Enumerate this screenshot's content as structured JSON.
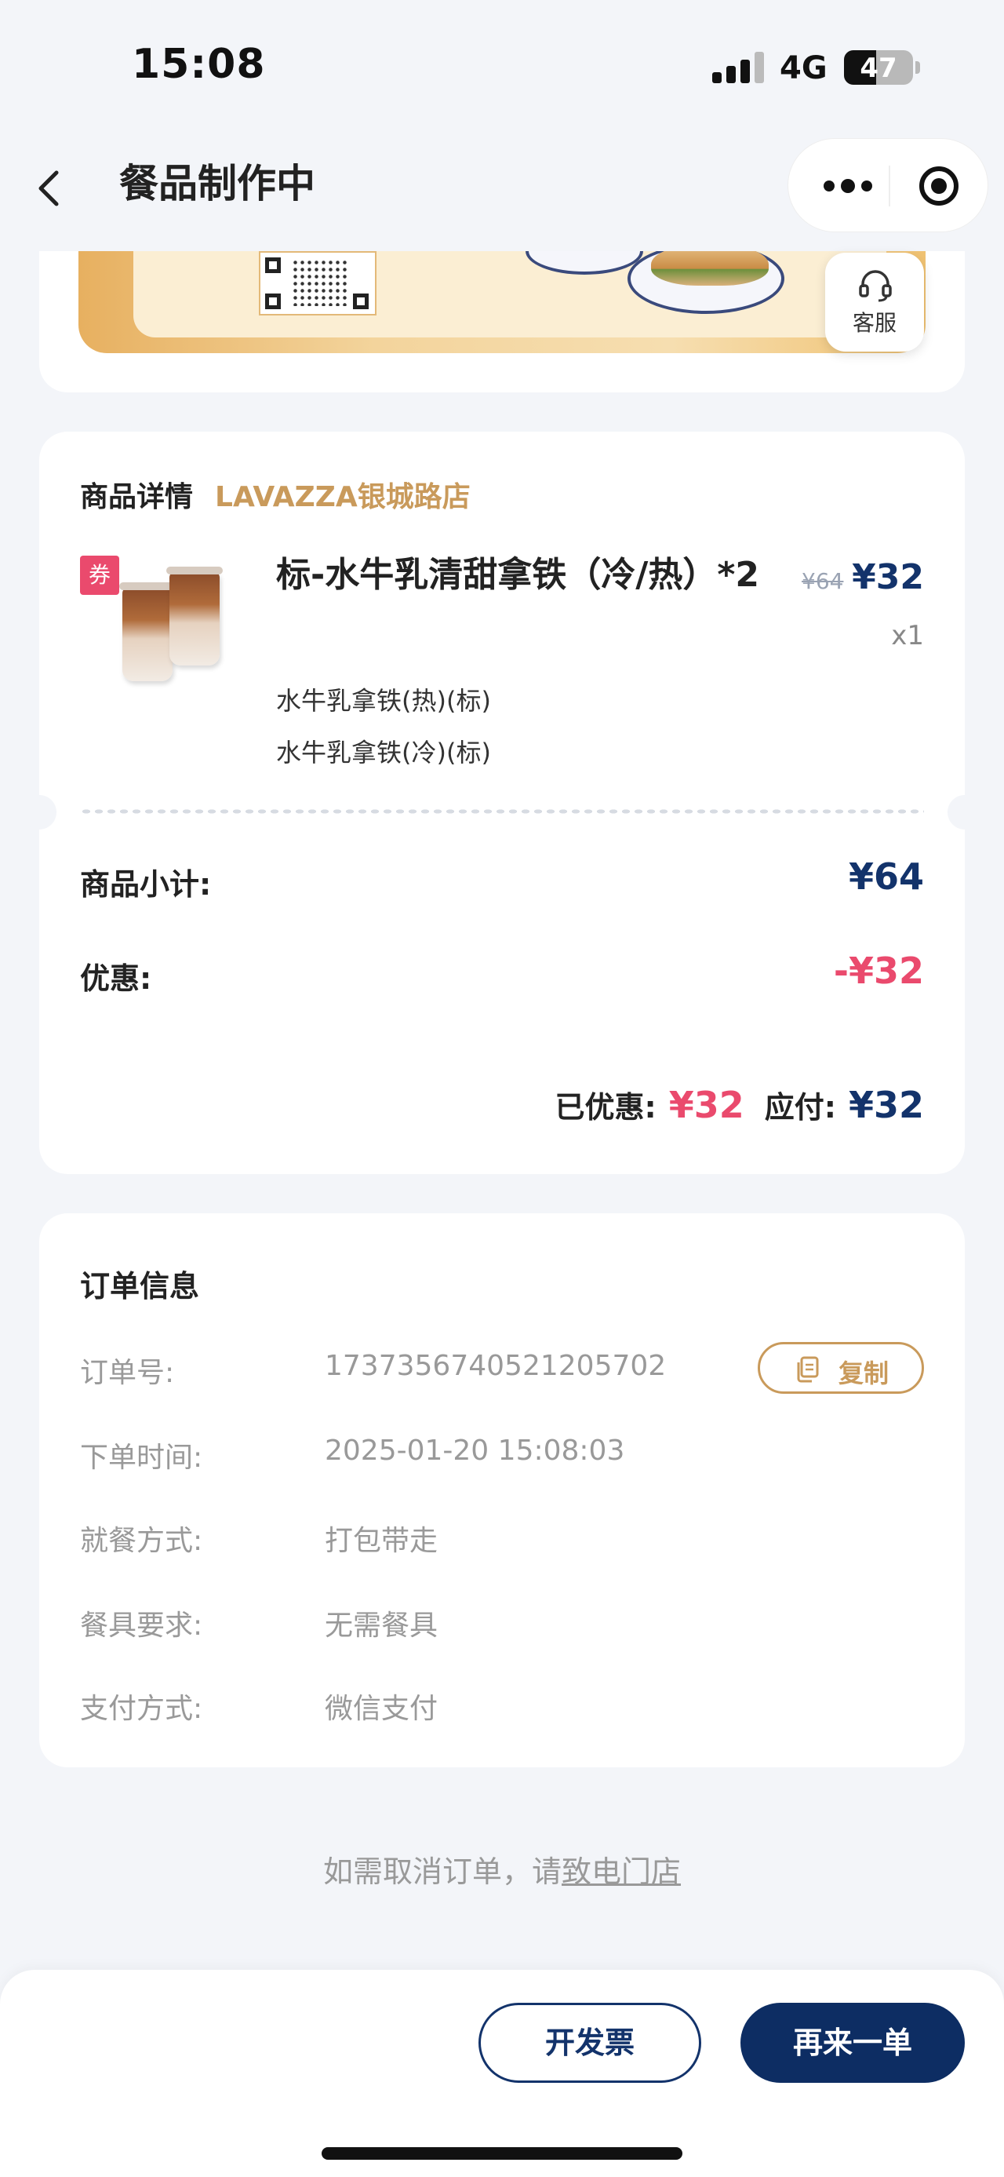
{
  "status_bar": {
    "time": "15:08",
    "network": "4G",
    "battery": "47",
    "battery_level": 0.47
  },
  "nav": {
    "title": "餐品制作中"
  },
  "service": {
    "label": "客服"
  },
  "product_section": {
    "title": "商品详情",
    "store": "LAVAZZA银城路店",
    "coupon_tag": "券",
    "item": {
      "name": "标-水牛乳清甜拿铁（冷/热）*2",
      "original_price": "¥64",
      "price": "¥32",
      "quantity": "x1",
      "options": [
        "水牛乳拿铁(热)(标)",
        "水牛乳拿铁(冷)(标)"
      ]
    },
    "subtotal_label": "商品小计:",
    "subtotal_value": "¥64",
    "discount_label": "优惠:",
    "discount_value": "-¥32",
    "saved_label": "已优惠:",
    "saved_value": "¥32",
    "payable_label": "应付:",
    "payable_value": "¥32"
  },
  "order_info": {
    "title": "订单信息",
    "copy_label": "复制",
    "rows": [
      {
        "label": "订单号:",
        "value": "1737356740521205702"
      },
      {
        "label": "下单时间:",
        "value": "2025-01-20 15:08:03"
      },
      {
        "label": "就餐方式:",
        "value": "打包带走"
      },
      {
        "label": "餐具要求:",
        "value": "无需餐具"
      },
      {
        "label": "支付方式:",
        "value": "微信支付"
      }
    ]
  },
  "cancel_hint": {
    "prefix": "如需取消订单，请",
    "link": "致电门店"
  },
  "actions": {
    "invoice": "开发票",
    "reorder": "再来一单"
  },
  "colors": {
    "navy": "#13336b",
    "accent_gold": "#c99a5b",
    "discount_red": "#ea4a6d"
  }
}
